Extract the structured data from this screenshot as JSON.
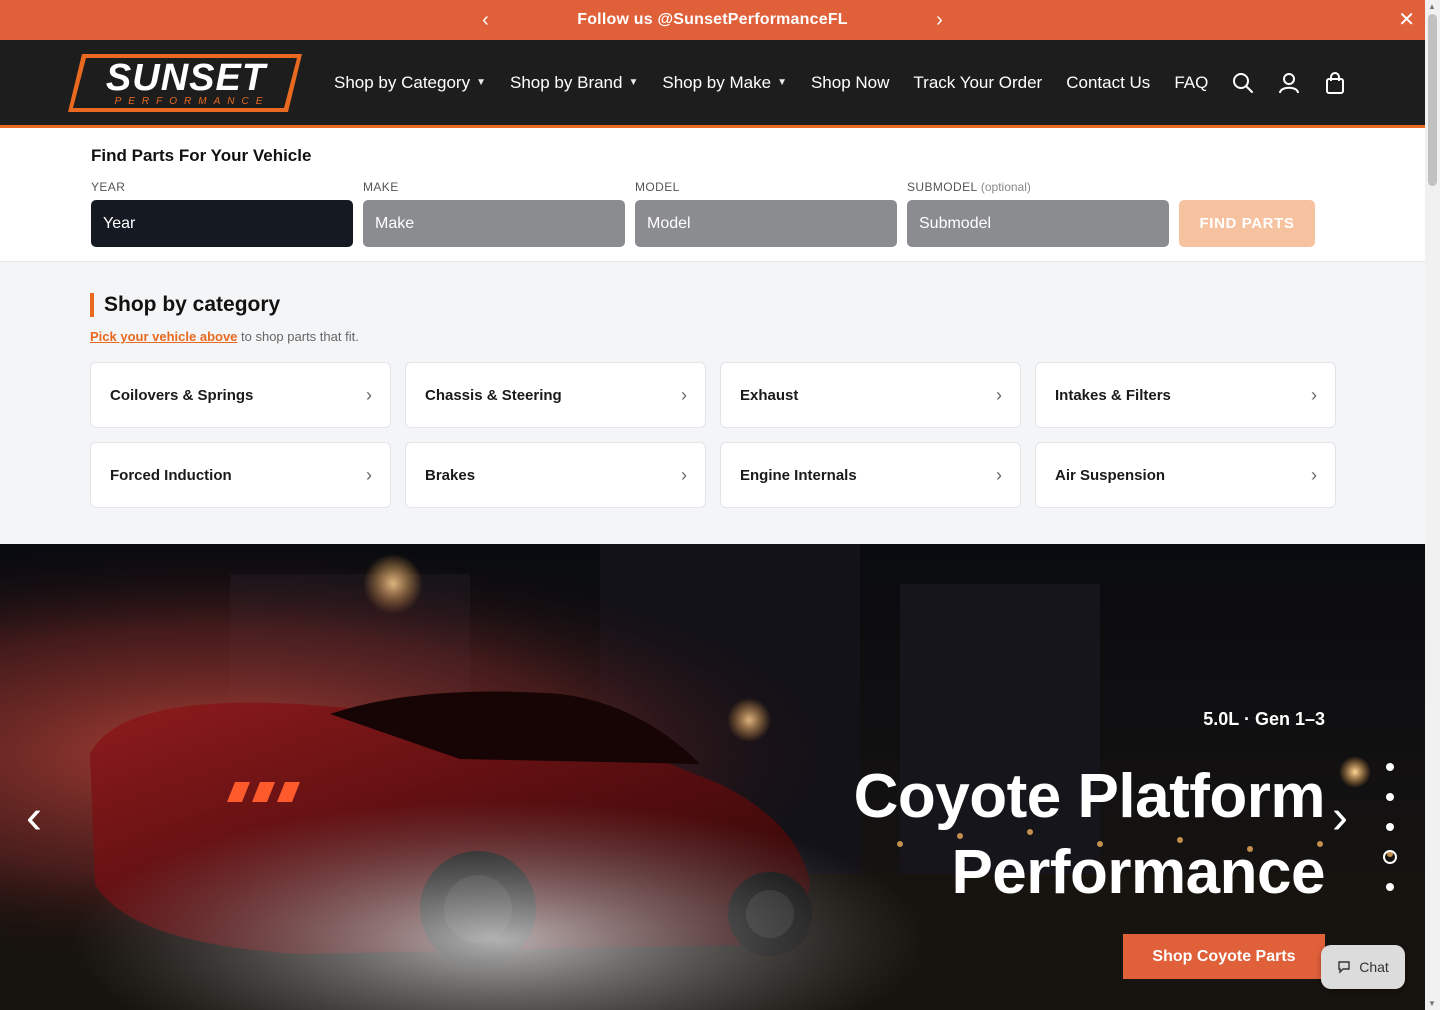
{
  "announcement": {
    "message": "Follow us @SunsetPerformanceFL",
    "prev": "‹",
    "next": "›",
    "close": "✕"
  },
  "brand": {
    "name": "SUNSET",
    "tagline": "PERFORMANCE",
    "accent": "#e8691f",
    "bar_color": "#e0603a"
  },
  "nav": {
    "items": [
      {
        "label": "Shop by Category",
        "dropdown": "⌄"
      },
      {
        "label": "Shop by Brand",
        "dropdown": "⌄"
      },
      {
        "label": "Shop by Make",
        "dropdown": "⌄"
      },
      {
        "label": "Shop Now"
      },
      {
        "label": "Track Your Order"
      },
      {
        "label": "Contact Us"
      },
      {
        "label": "FAQ"
      }
    ],
    "icons": [
      "search-icon",
      "account-icon",
      "cart-icon"
    ]
  },
  "finder": {
    "title": "Find Parts For Your Vehicle",
    "fields": [
      {
        "label": "YEAR",
        "optional": "",
        "placeholder": "Year"
      },
      {
        "label": "MAKE",
        "optional": "",
        "placeholder": "Make"
      },
      {
        "label": "MODEL",
        "optional": "",
        "placeholder": "Model"
      },
      {
        "label": "SUBMODEL",
        "optional": "(optional)",
        "placeholder": "Submodel"
      }
    ],
    "button": "FIND PARTS"
  },
  "categories": {
    "title": "Shop by category",
    "sub_link": "Pick your vehicle above",
    "sub_text": " to shop parts that fit.",
    "items": [
      "Coilovers & Springs",
      "Chassis & Steering",
      "Exhaust",
      "Intakes & Filters",
      "Forced Induction",
      "Brakes",
      "Engine Internals",
      "Air Suspension"
    ],
    "chevron": "›"
  },
  "hero": {
    "eyebrow": "5.0L · Gen 1–3",
    "headline_line1": "Coyote Platform",
    "headline_line2": "Performance",
    "cta": "Shop Coyote Parts",
    "prev": "‹",
    "next": "›",
    "slide_count": 5,
    "active_slide": 4
  },
  "chat": {
    "label": "Chat"
  }
}
